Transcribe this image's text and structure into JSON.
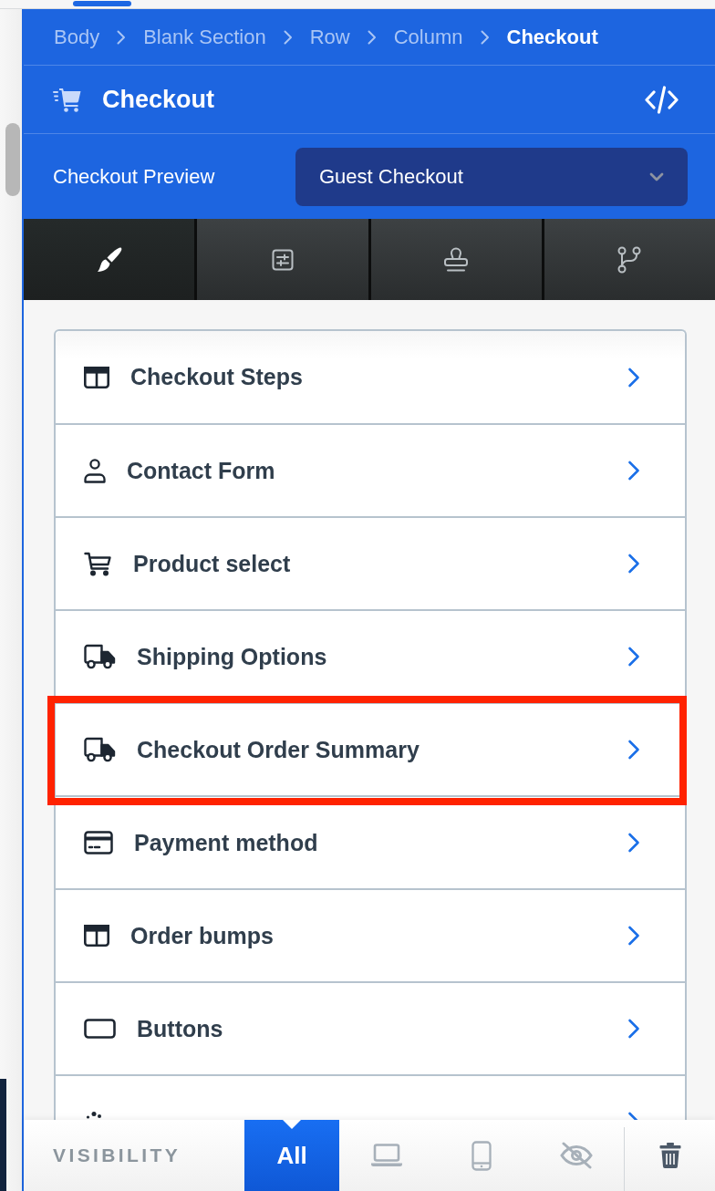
{
  "breadcrumb": [
    {
      "label": "Body",
      "current": false
    },
    {
      "label": "Blank Section",
      "current": false
    },
    {
      "label": "Row",
      "current": false
    },
    {
      "label": "Column",
      "current": false
    },
    {
      "label": "Checkout",
      "current": true
    }
  ],
  "header": {
    "title": "Checkout"
  },
  "preview": {
    "label": "Checkout Preview",
    "value": "Guest Checkout"
  },
  "tabs": [
    {
      "selected": true
    },
    {
      "selected": false
    },
    {
      "selected": false
    },
    {
      "selected": false
    }
  ],
  "sections": [
    {
      "label": "Checkout Steps",
      "highlighted": false
    },
    {
      "label": "Contact Form",
      "highlighted": false
    },
    {
      "label": "Product select",
      "highlighted": false
    },
    {
      "label": "Shipping Options",
      "highlighted": false
    },
    {
      "label": "Checkout Order Summary",
      "highlighted": true
    },
    {
      "label": "Payment method",
      "highlighted": false
    },
    {
      "label": "Order bumps",
      "highlighted": false
    },
    {
      "label": "Buttons",
      "highlighted": false
    },
    {
      "highlighted": false
    }
  ],
  "visibility": {
    "label": "VISIBILITY",
    "options": [
      {
        "label": "All",
        "selected": true
      },
      {
        "selected": false
      },
      {
        "selected": false
      },
      {
        "selected": false
      }
    ]
  }
}
